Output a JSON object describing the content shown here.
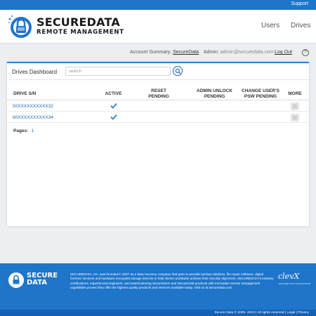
{
  "topbar": {
    "support": "Support"
  },
  "header": {
    "brand_line1": "SECUREDATA",
    "brand_line2": "REMOTE MANAGEMENT",
    "nav": [
      "Users",
      "Drives"
    ]
  },
  "account": {
    "summary_label": "Account Summary:",
    "summary_link": "SecureData",
    "admin_label": "Admin:",
    "admin_email": "admin@securedata.com",
    "logout": "Log Out",
    "help": "?"
  },
  "dashboard": {
    "title": "Drives Dashboard",
    "search_placeholder": "search",
    "columns": {
      "drive": "DRIVE S/N",
      "active": "ACTIVE",
      "reset_line1": "RESET",
      "reset_line2": "PENDING",
      "admin_line1": "ADMIN UNLOCK",
      "admin_line2": "PENDING",
      "psw_line1": "CHANGE USER'S",
      "psw_line2": "PSW PENDING",
      "more": "MORE"
    },
    "rows": [
      {
        "sn": "50XXXXXXXXXX32",
        "active": true
      },
      {
        "sn": "60XXXXXXXXXX34",
        "active": true
      }
    ],
    "pages_label": "Pages:",
    "current_page": "1"
  },
  "footer": {
    "brand_line1": "SECURE",
    "brand_line2": "DATA",
    "text": "SECUREDATA, Inc. was founded in 2007 as a data recovery company that grew to provide backup solutions, file repair software, digital forensic services and hardware encrypted storage devices to help clients worldwide achieve their security objectives. SECUREDATA's industry certifications, experienced engineers, and award-winning SecureDrive and SecureUSB products with innovative remote management capabilities proves they offer the highest quality products and services available today. Visit us at securedata.com",
    "partner": "clevX",
    "partner_sub": "SECURE DATA SOLUTIONS",
    "copyright": "Secure Data © 2005- 2019  |  All rights reserved  |  Legal  |  Privacy"
  },
  "colors": {
    "accent": "#1e75c9",
    "link": "#1e63b5",
    "footer": "#1e75c9"
  }
}
